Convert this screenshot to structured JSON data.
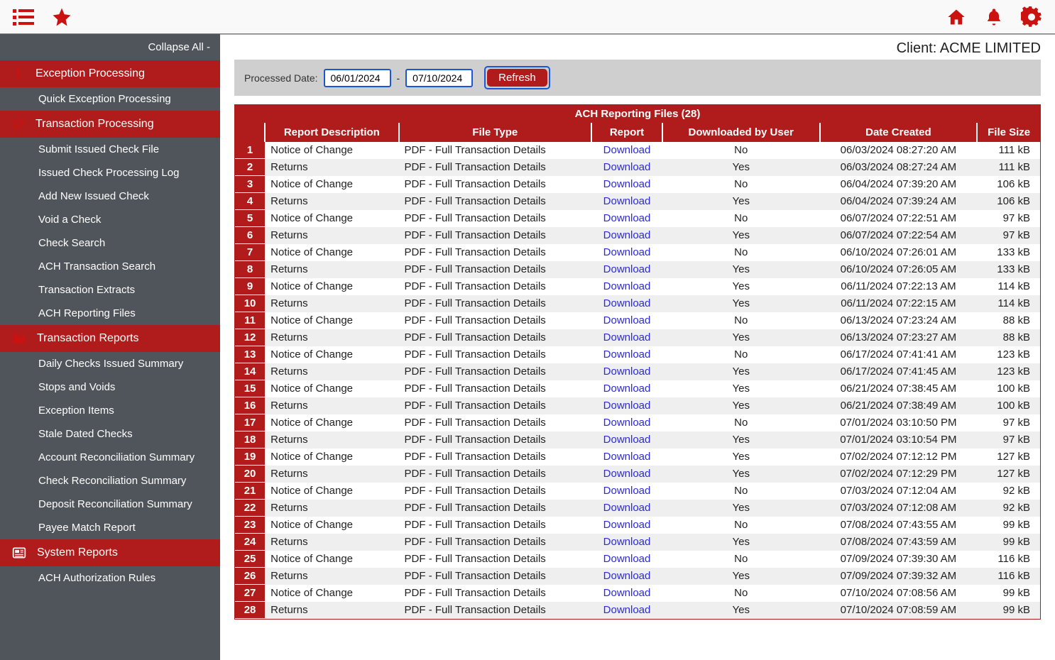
{
  "topbar": {
    "icons_left": [
      "menu-list-icon",
      "star-icon"
    ],
    "icons_right": [
      "home-icon",
      "bell-icon",
      "gear-icon"
    ]
  },
  "client_label": "Client: ACME LIMITED",
  "sidebar": {
    "collapse_label": "Collapse All -",
    "sections": [
      {
        "title": "Exception Processing",
        "icon": "exclaim",
        "items": [
          "Quick Exception Processing"
        ]
      },
      {
        "title": "Transaction Processing",
        "icon": "refresh",
        "items": [
          "Submit Issued Check File",
          "Issued Check Processing Log",
          "Add New Issued Check",
          "Void a Check",
          "Check Search",
          "ACH Transaction Search",
          "Transaction Extracts",
          "ACH Reporting Files"
        ]
      },
      {
        "title": "Transaction Reports",
        "icon": "folder",
        "items": [
          "Daily Checks Issued Summary",
          "Stops and Voids",
          "Exception Items",
          "Stale Dated Checks",
          "Account Reconciliation Summary",
          "Check Reconciliation Summary",
          "Deposit Reconciliation Summary",
          "Payee Match Report"
        ]
      },
      {
        "title": "System Reports",
        "icon": "news",
        "items": [
          "ACH Authorization Rules"
        ]
      }
    ]
  },
  "filter": {
    "label": "Processed Date:",
    "from": "06/01/2024",
    "dash": "-",
    "to": "07/10/2024",
    "refresh": "Refresh"
  },
  "table": {
    "title": "ACH Reporting Files (28)",
    "columns": [
      "",
      "Report Description",
      "File Type",
      "Report",
      "Downloaded by User",
      "Date Created",
      "File Size"
    ],
    "download_label": "Download",
    "rows": [
      {
        "n": 1,
        "desc": "Notice of Change",
        "ft": "PDF - Full Transaction Details",
        "dl": "No",
        "date": "06/03/2024 08:27:20 AM",
        "size": "111 kB"
      },
      {
        "n": 2,
        "desc": "Returns",
        "ft": "PDF - Full Transaction Details",
        "dl": "Yes",
        "date": "06/03/2024 08:27:24 AM",
        "size": "111 kB"
      },
      {
        "n": 3,
        "desc": "Notice of Change",
        "ft": "PDF - Full Transaction Details",
        "dl": "No",
        "date": "06/04/2024 07:39:20 AM",
        "size": "106 kB"
      },
      {
        "n": 4,
        "desc": "Returns",
        "ft": "PDF - Full Transaction Details",
        "dl": "Yes",
        "date": "06/04/2024 07:39:24 AM",
        "size": "106 kB"
      },
      {
        "n": 5,
        "desc": "Notice of Change",
        "ft": "PDF - Full Transaction Details",
        "dl": "No",
        "date": "06/07/2024 07:22:51 AM",
        "size": "97 kB"
      },
      {
        "n": 6,
        "desc": "Returns",
        "ft": "PDF - Full Transaction Details",
        "dl": "Yes",
        "date": "06/07/2024 07:22:54 AM",
        "size": "97 kB"
      },
      {
        "n": 7,
        "desc": "Notice of Change",
        "ft": "PDF - Full Transaction Details",
        "dl": "No",
        "date": "06/10/2024 07:26:01 AM",
        "size": "133 kB"
      },
      {
        "n": 8,
        "desc": "Returns",
        "ft": "PDF - Full Transaction Details",
        "dl": "Yes",
        "date": "06/10/2024 07:26:05 AM",
        "size": "133 kB"
      },
      {
        "n": 9,
        "desc": "Notice of Change",
        "ft": "PDF - Full Transaction Details",
        "dl": "Yes",
        "date": "06/11/2024 07:22:13 AM",
        "size": "114 kB"
      },
      {
        "n": 10,
        "desc": "Returns",
        "ft": "PDF - Full Transaction Details",
        "dl": "Yes",
        "date": "06/11/2024 07:22:15 AM",
        "size": "114 kB"
      },
      {
        "n": 11,
        "desc": "Notice of Change",
        "ft": "PDF - Full Transaction Details",
        "dl": "No",
        "date": "06/13/2024 07:23:24 AM",
        "size": "88 kB"
      },
      {
        "n": 12,
        "desc": "Returns",
        "ft": "PDF - Full Transaction Details",
        "dl": "Yes",
        "date": "06/13/2024 07:23:27 AM",
        "size": "88 kB"
      },
      {
        "n": 13,
        "desc": "Notice of Change",
        "ft": "PDF - Full Transaction Details",
        "dl": "No",
        "date": "06/17/2024 07:41:41 AM",
        "size": "123 kB"
      },
      {
        "n": 14,
        "desc": "Returns",
        "ft": "PDF - Full Transaction Details",
        "dl": "Yes",
        "date": "06/17/2024 07:41:45 AM",
        "size": "123 kB"
      },
      {
        "n": 15,
        "desc": "Notice of Change",
        "ft": "PDF - Full Transaction Details",
        "dl": "Yes",
        "date": "06/21/2024 07:38:45 AM",
        "size": "100 kB"
      },
      {
        "n": 16,
        "desc": "Returns",
        "ft": "PDF - Full Transaction Details",
        "dl": "Yes",
        "date": "06/21/2024 07:38:49 AM",
        "size": "100 kB"
      },
      {
        "n": 17,
        "desc": "Notice of Change",
        "ft": "PDF - Full Transaction Details",
        "dl": "No",
        "date": "07/01/2024 03:10:50 PM",
        "size": "97 kB"
      },
      {
        "n": 18,
        "desc": "Returns",
        "ft": "PDF - Full Transaction Details",
        "dl": "Yes",
        "date": "07/01/2024 03:10:54 PM",
        "size": "97 kB"
      },
      {
        "n": 19,
        "desc": "Notice of Change",
        "ft": "PDF - Full Transaction Details",
        "dl": "Yes",
        "date": "07/02/2024 07:12:12 PM",
        "size": "127 kB"
      },
      {
        "n": 20,
        "desc": "Returns",
        "ft": "PDF - Full Transaction Details",
        "dl": "Yes",
        "date": "07/02/2024 07:12:29 PM",
        "size": "127 kB"
      },
      {
        "n": 21,
        "desc": "Notice of Change",
        "ft": "PDF - Full Transaction Details",
        "dl": "No",
        "date": "07/03/2024 07:12:04 AM",
        "size": "92 kB"
      },
      {
        "n": 22,
        "desc": "Returns",
        "ft": "PDF - Full Transaction Details",
        "dl": "Yes",
        "date": "07/03/2024 07:12:08 AM",
        "size": "92 kB"
      },
      {
        "n": 23,
        "desc": "Notice of Change",
        "ft": "PDF - Full Transaction Details",
        "dl": "No",
        "date": "07/08/2024 07:43:55 AM",
        "size": "99 kB"
      },
      {
        "n": 24,
        "desc": "Returns",
        "ft": "PDF - Full Transaction Details",
        "dl": "Yes",
        "date": "07/08/2024 07:43:59 AM",
        "size": "99 kB"
      },
      {
        "n": 25,
        "desc": "Notice of Change",
        "ft": "PDF - Full Transaction Details",
        "dl": "No",
        "date": "07/09/2024 07:39:30 AM",
        "size": "116 kB"
      },
      {
        "n": 26,
        "desc": "Returns",
        "ft": "PDF - Full Transaction Details",
        "dl": "Yes",
        "date": "07/09/2024 07:39:32 AM",
        "size": "116 kB"
      },
      {
        "n": 27,
        "desc": "Notice of Change",
        "ft": "PDF - Full Transaction Details",
        "dl": "No",
        "date": "07/10/2024 07:08:56 AM",
        "size": "99 kB"
      },
      {
        "n": 28,
        "desc": "Returns",
        "ft": "PDF - Full Transaction Details",
        "dl": "Yes",
        "date": "07/10/2024 07:08:59 AM",
        "size": "99 kB"
      }
    ]
  }
}
